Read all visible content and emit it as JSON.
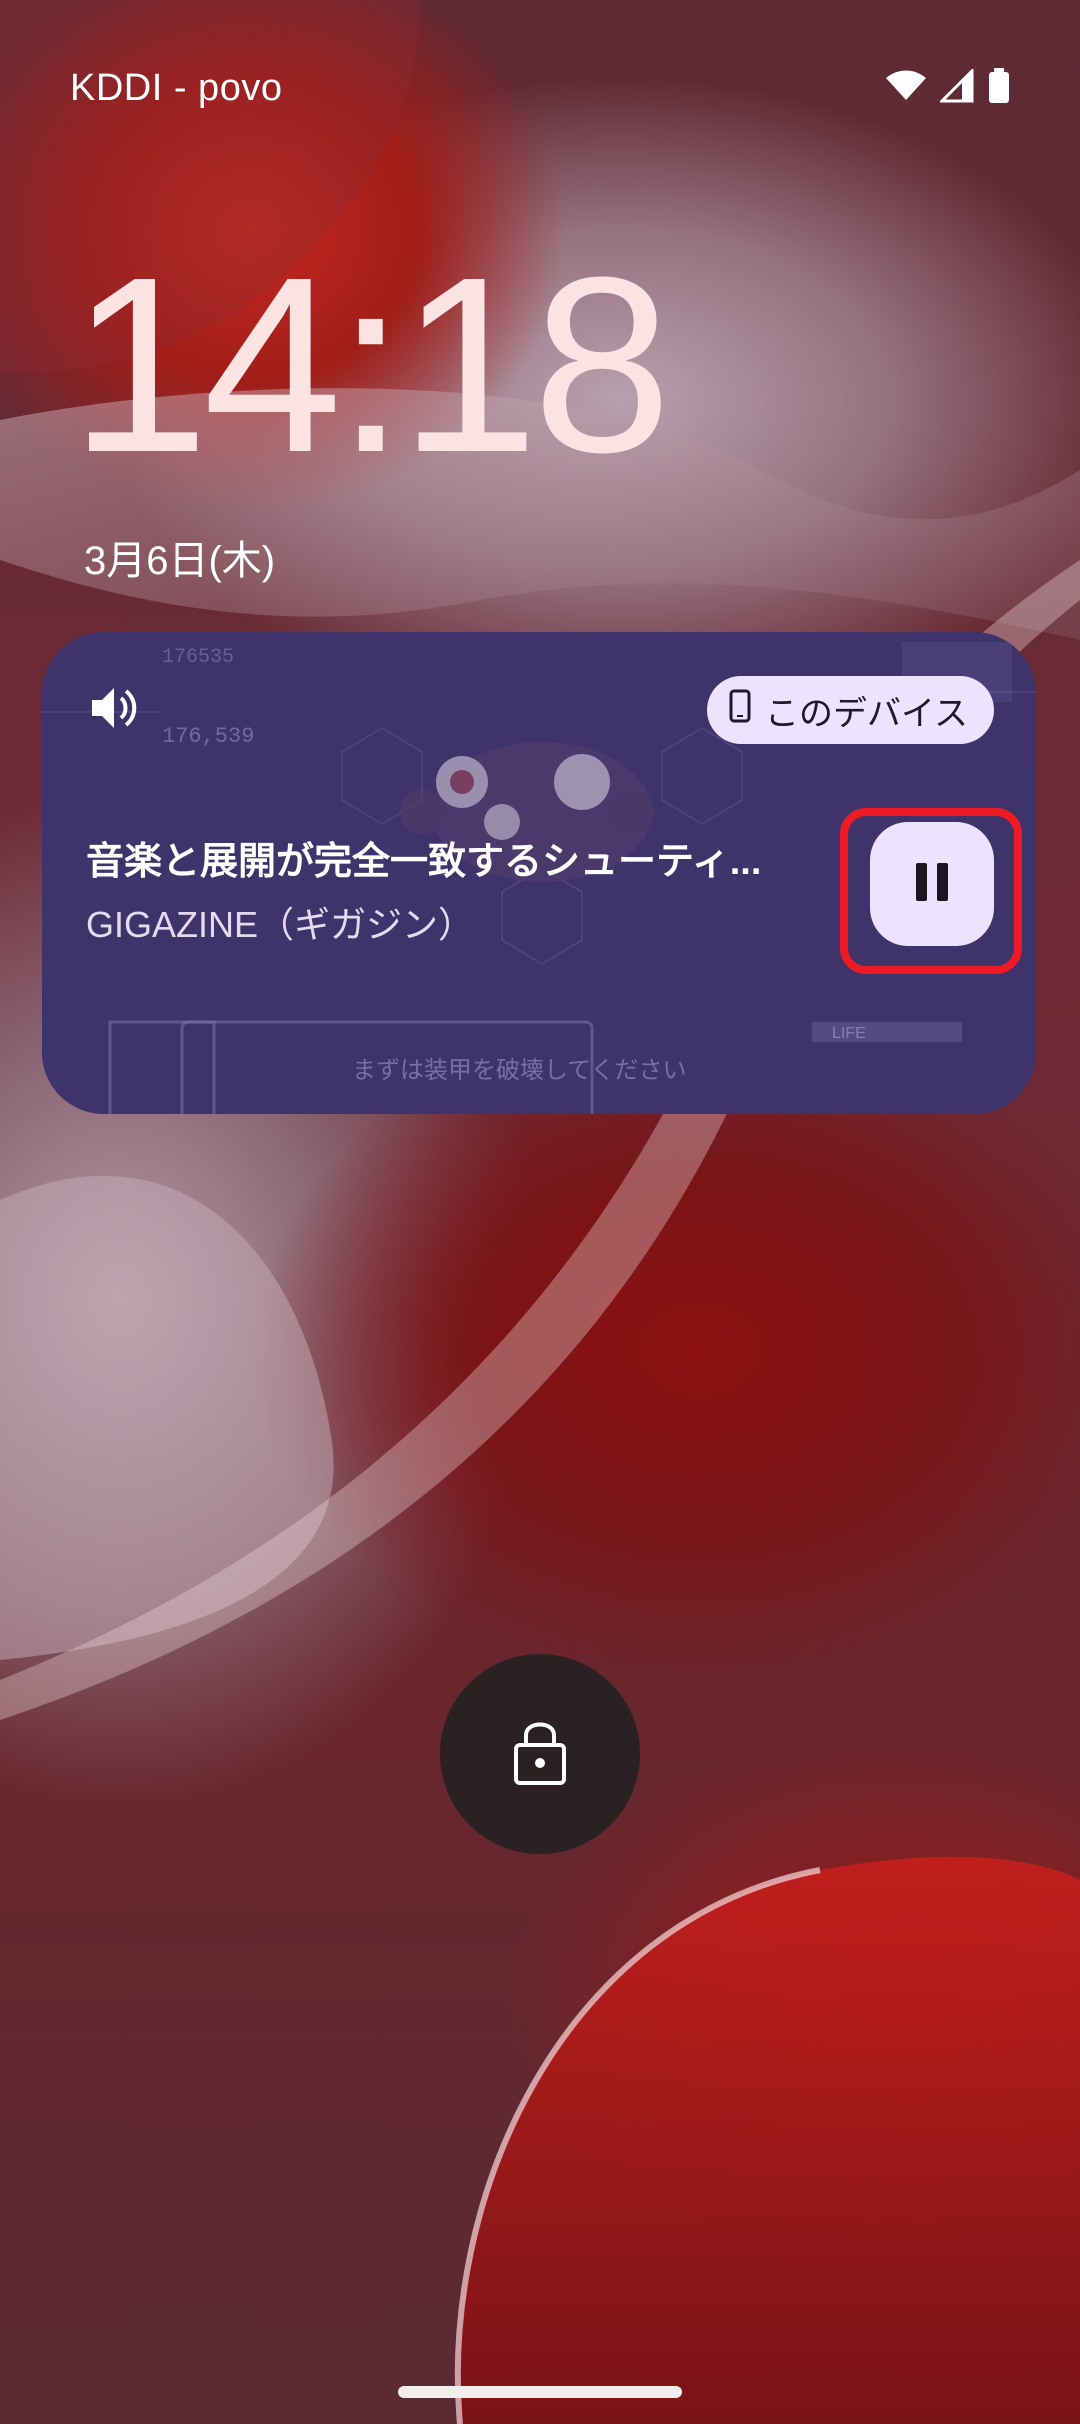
{
  "status_bar": {
    "carrier": "KDDI - povo",
    "icons": [
      "wifi-icon",
      "cellular-signal-icon",
      "battery-icon"
    ]
  },
  "lock_screen": {
    "time": "14:18",
    "date": "3月6日(木)"
  },
  "media_player": {
    "output_icon": "speaker-icon",
    "device_chip": {
      "icon": "phone-icon",
      "label": "このデバイス"
    },
    "title": "音楽と展開が完全一致するシューティ...",
    "artist": "GIGAZINE（ギガジン）",
    "artwork_text": {
      "score_top": "176535",
      "score_mid": "176,539",
      "caption": "まずは装甲を破壊してください",
      "life_label": "LIFE"
    },
    "play_state_button": "pause-icon"
  },
  "lock_icon": "lock-icon",
  "colors": {
    "chip_background": "#ece3ff",
    "highlight": "#ee1b24",
    "clock": "#fbe3e2"
  }
}
